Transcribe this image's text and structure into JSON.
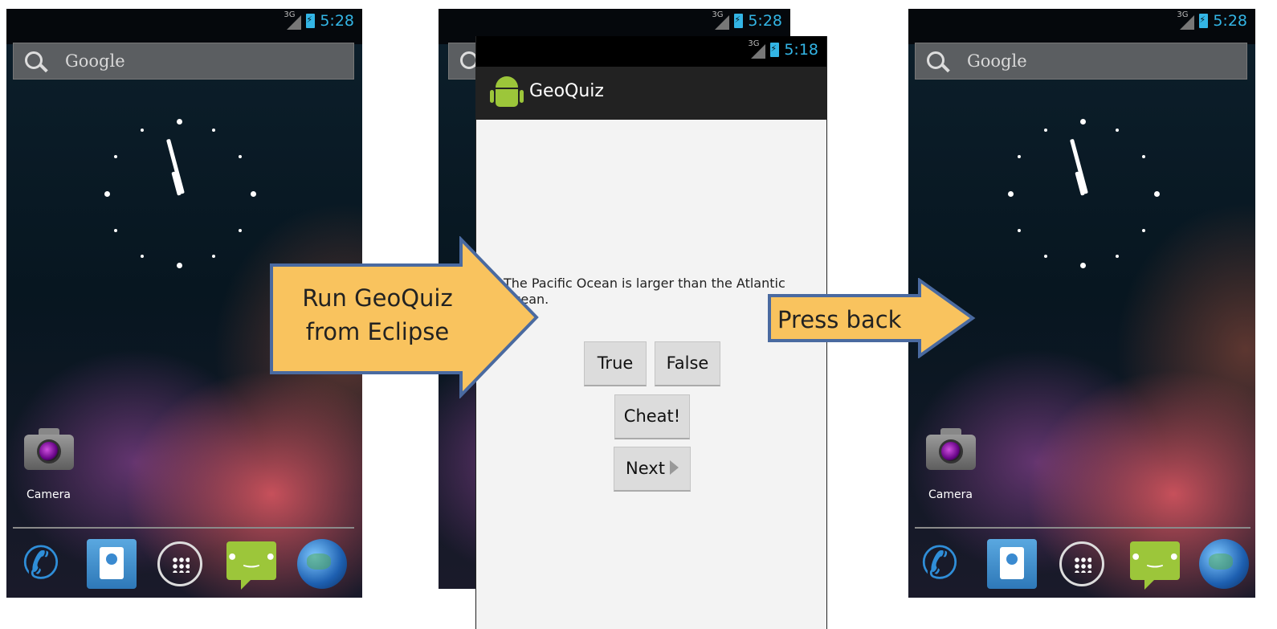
{
  "status": {
    "left_time": "5:28",
    "app_time": "5:18",
    "right_time": "5:28",
    "network": "3G"
  },
  "search": {
    "label": "Google"
  },
  "home": {
    "camera_label": "Camera"
  },
  "app": {
    "title": "GeoQuiz",
    "question": "The Pacific Ocean is larger than the Atlantic Ocean.",
    "true_label": "True",
    "false_label": "False",
    "cheat_label": "Cheat!",
    "next_label": "Next"
  },
  "arrows": {
    "run_line1": "Run GeoQuiz",
    "run_line2": "from Eclipse",
    "back_label": "Press back"
  },
  "colors": {
    "arrow_fill": "#f9c35e",
    "arrow_stroke": "#4a6aa0",
    "status_accent": "#33b5e5"
  }
}
